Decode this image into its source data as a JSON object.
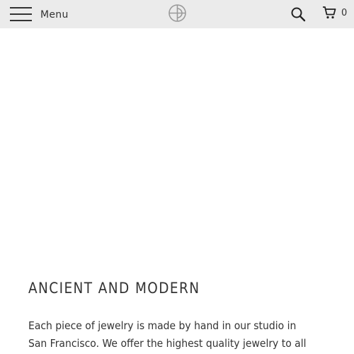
{
  "header": {
    "menu_label": "Menu",
    "cart_count": "0"
  },
  "icons": {
    "menu": "hamburger-icon",
    "logo": "circle-logo-icon",
    "search": "search-icon",
    "cart": "cart-icon"
  },
  "main": {
    "heading": "ANCIENT AND MODERN",
    "body": "Each piece of jewelry is made by hand in our studio in San Francisco. We offer the highest quality jewelry to all of"
  },
  "colors": {
    "header_bg": "#ebebeb",
    "text": "#333333",
    "page_bg": "#ffffff"
  }
}
